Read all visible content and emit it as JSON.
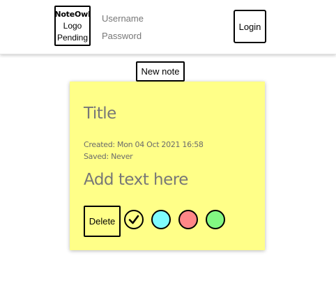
{
  "header": {
    "logo": {
      "brand": "NoteOwl",
      "line2": "Logo",
      "line3": "Pending"
    },
    "login": {
      "username_placeholder": "Username",
      "username_value": "",
      "password_placeholder": "Password",
      "password_value": "",
      "login_label": "Login"
    }
  },
  "toolbar": {
    "new_note_label": "New note"
  },
  "note": {
    "background_color": "#ffff88",
    "title_placeholder": "Title",
    "created": "Created: Mon 04 Oct 2021 16:58",
    "saved": "Saved: Never",
    "body_placeholder": "Add text here",
    "delete_label": "Delete",
    "color_options": [
      {
        "name": "yellow",
        "color": "#ffff88",
        "selected": true,
        "icon": "check-icon"
      },
      {
        "name": "cyan",
        "color": "#7ffcff"
      },
      {
        "name": "red",
        "color": "#ff8787"
      },
      {
        "name": "green",
        "color": "#82f882"
      }
    ]
  }
}
